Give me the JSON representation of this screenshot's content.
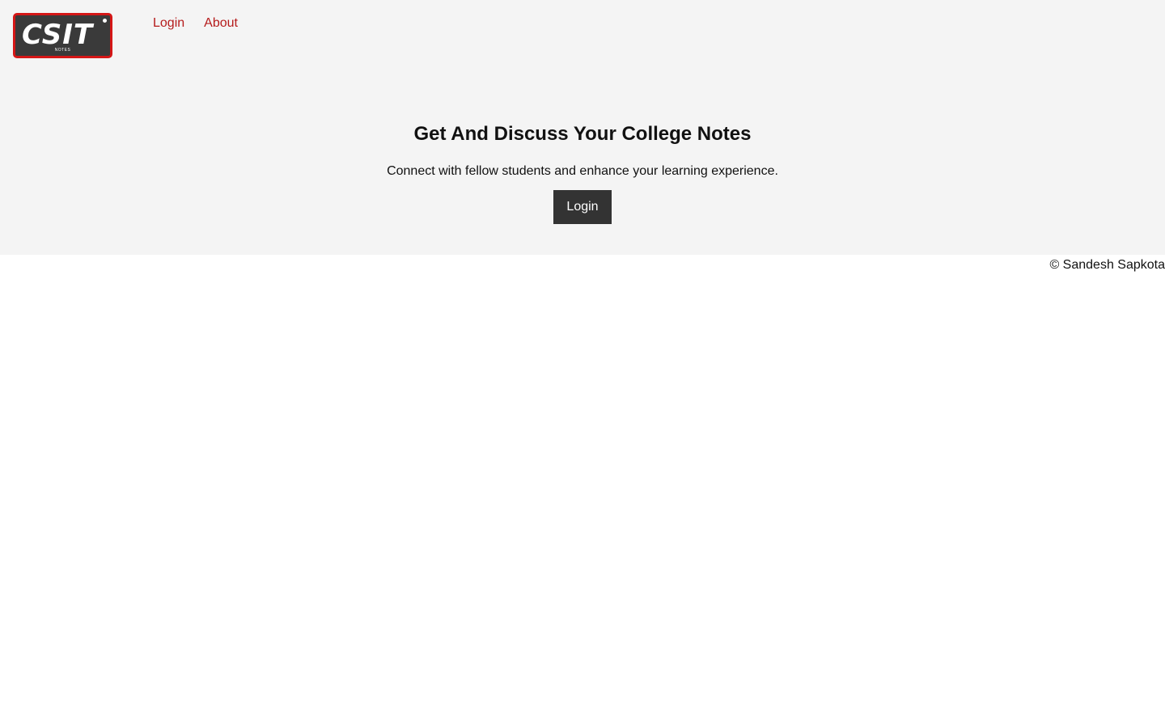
{
  "header": {
    "logo_text": "CSIT",
    "logo_sub": "NOTES",
    "nav": {
      "login": "Login",
      "about": "About"
    }
  },
  "hero": {
    "title": "Get And Discuss Your College Notes",
    "subtitle": "Connect with fellow students and enhance your learning experience.",
    "button_label": "Login"
  },
  "footer": {
    "copyright": "© Sandesh Sapkota"
  },
  "colors": {
    "nav_link": "#b51b1b",
    "logo_border": "#d41616",
    "button_bg": "#333333",
    "top_bg": "#f4f4f4"
  }
}
